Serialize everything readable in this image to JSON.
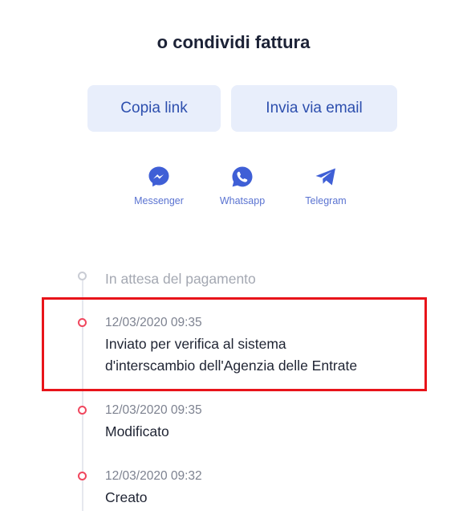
{
  "share": {
    "title": "o condividi fattura",
    "copy_link_label": "Copia link",
    "email_label": "Invia via email",
    "apps": [
      {
        "label": "Messenger",
        "icon": "messenger-icon"
      },
      {
        "label": "Whatsapp",
        "icon": "whatsapp-icon"
      },
      {
        "label": "Telegram",
        "icon": "telegram-icon"
      }
    ]
  },
  "timeline": {
    "pending_label": "In attesa del pagamento",
    "events": [
      {
        "date": "12/03/2020 09:35",
        "line1": "Inviato per verifica al sistema",
        "line2": "d'interscambio dell'Agenzia delle Entrate"
      },
      {
        "date": "12/03/2020 09:35",
        "line1": "Modificato"
      },
      {
        "date": "12/03/2020 09:32",
        "line1": "Creato"
      }
    ]
  },
  "colors": {
    "accent": "#2d4fae",
    "button_bg": "#e8eefb",
    "share_icon": "#3f5fd6",
    "event_dot": "#f0475e",
    "highlight": "#e8141a"
  }
}
